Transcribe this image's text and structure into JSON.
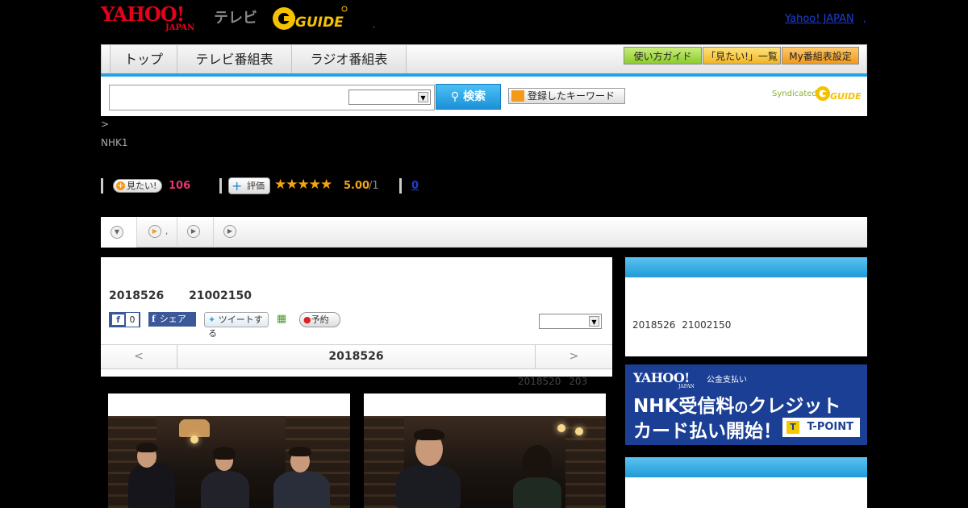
{
  "header": {
    "logo_yahoo": "YAHOO!",
    "logo_japan": "JAPAN",
    "logo_tv": "テレビ",
    "logo_gguide": "G GUIDE",
    "dot": ",",
    "yahoo_japan_link": "Yahoo! JAPAN",
    "comma": ","
  },
  "nav": {
    "tabs": [
      {
        "label": "トップ"
      },
      {
        "label": "テレビ番組表"
      },
      {
        "label": "ラジオ番組表"
      }
    ],
    "buttons": [
      {
        "label": "使い方ガイド",
        "color": "#8ccc2c"
      },
      {
        "label": "「見たい!」一覧",
        "color": "#f2b524"
      },
      {
        "label": "My番組表設定",
        "color": "#f09a1c"
      }
    ],
    "accent_color": "#24a2e0"
  },
  "search": {
    "placeholder": "",
    "select_value": "",
    "button_label": "検索",
    "keyword_button_label": "登録したキーワード",
    "syndicated": "Syndicated"
  },
  "program": {
    "breadcrumb": ">",
    "channel": "NHK1",
    "want_label": "見たい!",
    "want_count": "106",
    "rate_label": "評価",
    "stars": "★★★★★",
    "rating": "5.00",
    "rating_count": "/1",
    "review_count": "0"
  },
  "subtabs": [
    {
      "icon": "chevron-down-icon"
    },
    {
      "icon": "play-icon",
      "suffix": ","
    },
    {
      "icon": "play-icon"
    },
    {
      "icon": "play-icon"
    }
  ],
  "main": {
    "airtime": "2018526 21002150",
    "fb_like_count": "0",
    "share_label": "シェア",
    "tweet_label": "ツイートする",
    "reserve_label": "予約",
    "select_value": "",
    "date_prev": "<",
    "date_label": "2018526",
    "date_next": ">",
    "updated": "2018520 203"
  },
  "sidebar": {
    "box1_text": "2018526 21002150",
    "ad": {
      "yahoo": "YAHOO!",
      "japan": "JAPAN",
      "sub": "公金支払い",
      "line1_a": "NHK受信料",
      "line1_b": "の",
      "line1_c": "クレジット",
      "line2": "カード払い開始！",
      "tpoint": "T-POINT",
      "tp_mark": "T",
      "bg_color": "#1b3f94"
    }
  }
}
